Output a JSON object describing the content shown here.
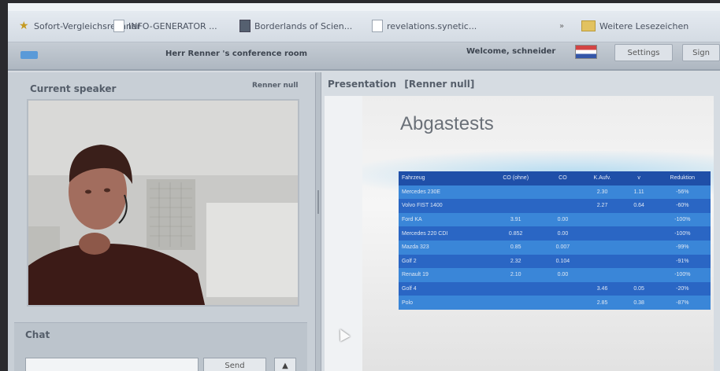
{
  "bookmarks": [
    {
      "label": "Sofort-Vergleichsrechner",
      "icon": "star-icon"
    },
    {
      "label": "INFO-GENERATOR ...",
      "icon": "page-icon"
    },
    {
      "label": "Borderlands of Scien...",
      "icon": "page-icon"
    },
    {
      "label": "revelations.synetic...",
      "icon": "page-icon"
    },
    {
      "label": "Weitere Lesezeichen",
      "icon": "folder-icon"
    }
  ],
  "app": {
    "room_title": "Herr Renner 's conference room",
    "welcome": "Welcome, schneider",
    "settings_label": "Settings",
    "logout_label": "Sign"
  },
  "speaker": {
    "title": "Current speaker",
    "name": "Renner null"
  },
  "chat": {
    "title": "Chat",
    "send_label": "Send",
    "scroll_label": "▲"
  },
  "presentation": {
    "title": "Presentation",
    "presenter": "[Renner null]",
    "slide_title": "Abgastests",
    "headers": [
      "Fahrzeug",
      "CO (ohne)",
      "CO",
      "K.Aufv.",
      "v",
      "Reduktion"
    ],
    "rows": [
      [
        "Mercedes 230E",
        "",
        "",
        "2.30",
        "1.11",
        "-56%"
      ],
      [
        "Volvo FIST 1400",
        "",
        "",
        "2.27",
        "0.64",
        "-60%"
      ],
      [
        "Ford KA",
        "3.91",
        "0.00",
        "",
        "",
        "-100%"
      ],
      [
        "Mercedes 220 CDI",
        "0.852",
        "0.00",
        "",
        "",
        "-100%"
      ],
      [
        "Mazda 323",
        "0.85",
        "0.007",
        "",
        "",
        "-99%"
      ],
      [
        "Golf 2",
        "2.32",
        "0.104",
        "",
        "",
        "-91%"
      ],
      [
        "Renault 19",
        "2.10",
        "0.00",
        "",
        "",
        "-100%"
      ],
      [
        "Golf 4",
        "",
        "",
        "3.46",
        "0.05",
        "-20%"
      ],
      [
        "Polo",
        "",
        "",
        "2.85",
        "0.38",
        "-87%"
      ]
    ]
  },
  "colors": {
    "table_header": "#1f4fa8",
    "table_row_light": "#3a86d8",
    "table_row_dark": "#2a66c4"
  }
}
